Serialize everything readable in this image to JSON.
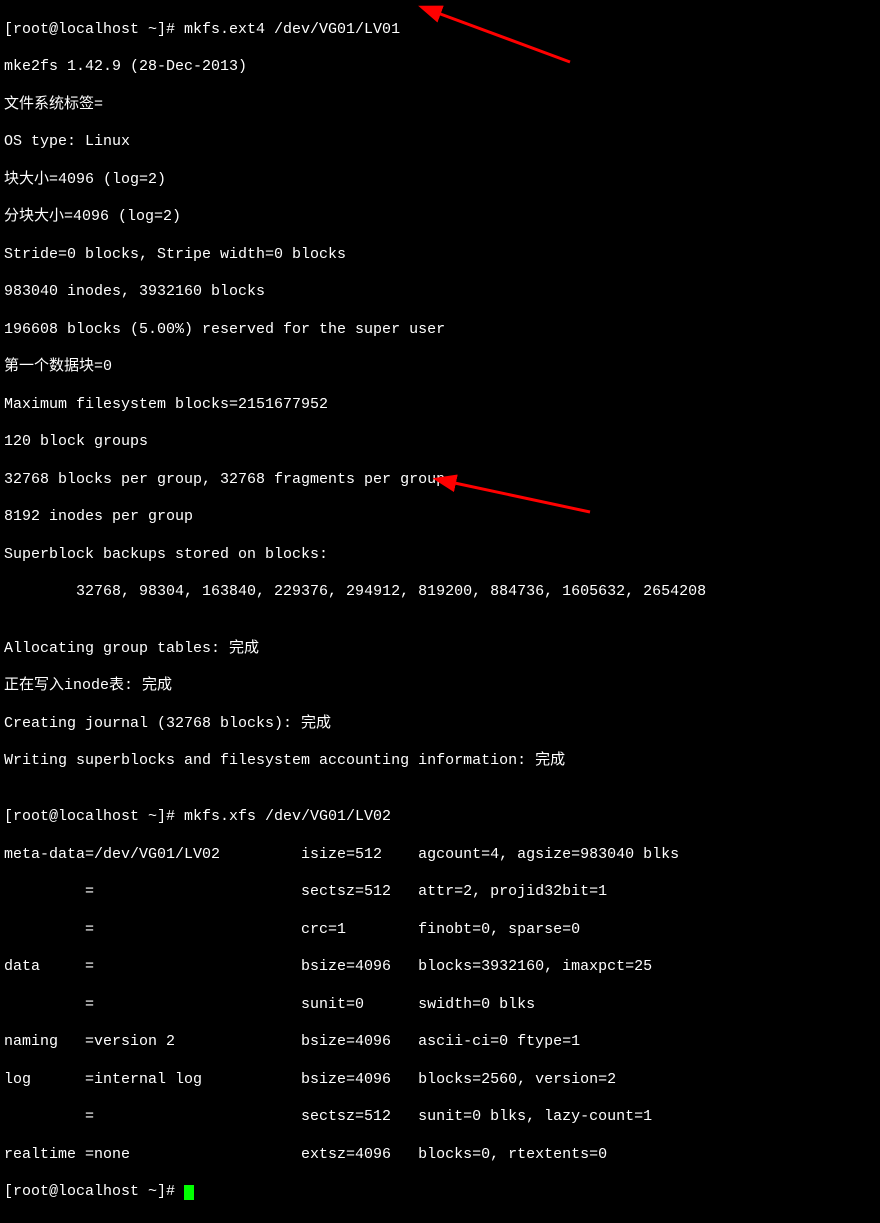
{
  "lines": [
    "[root@localhost ~]# mkfs.ext4 /dev/VG01/LV01",
    "mke2fs 1.42.9 (28-Dec-2013)",
    "文件系统标签=",
    "OS type: Linux",
    "块大小=4096 (log=2)",
    "分块大小=4096 (log=2)",
    "Stride=0 blocks, Stripe width=0 blocks",
    "983040 inodes, 3932160 blocks",
    "196608 blocks (5.00%) reserved for the super user",
    "第一个数据块=0",
    "Maximum filesystem blocks=2151677952",
    "120 block groups",
    "32768 blocks per group, 32768 fragments per group",
    "8192 inodes per group",
    "Superblock backups stored on blocks: ",
    "\t32768, 98304, 163840, 229376, 294912, 819200, 884736, 1605632, 2654208",
    "",
    "Allocating group tables: 完成                            ",
    "正在写入inode表: 完成                            ",
    "Creating journal (32768 blocks): 完成",
    "Writing superblocks and filesystem accounting information: 完成 ",
    "",
    "[root@localhost ~]# mkfs.xfs /dev/VG01/LV02",
    "meta-data=/dev/VG01/LV02         isize=512    agcount=4, agsize=983040 blks",
    "         =                       sectsz=512   attr=2, projid32bit=1",
    "         =                       crc=1        finobt=0, sparse=0",
    "data     =                       bsize=4096   blocks=3932160, imaxpct=25",
    "         =                       sunit=0      swidth=0 blks",
    "naming   =version 2              bsize=4096   ascii-ci=0 ftype=1",
    "log      =internal log           bsize=4096   blocks=2560, version=2",
    "         =                       sectsz=512   sunit=0 blks, lazy-count=1",
    "realtime =none                   extsz=4096   blocks=0, rtextents=0"
  ],
  "prompt_last": "[root@localhost ~]# ",
  "arrows": {
    "color": "#ff0000"
  }
}
